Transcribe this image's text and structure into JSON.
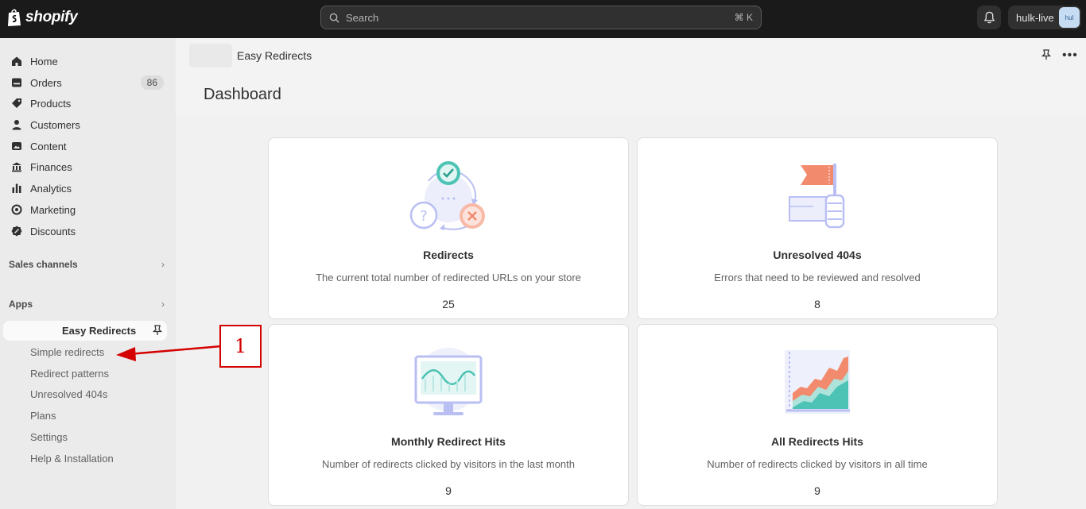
{
  "topbar": {
    "logo_text": "shopify",
    "search_placeholder": "Search",
    "search_shortcut": "⌘ K",
    "store_name": "hulk-live",
    "avatar_text": "hul"
  },
  "sidebar": {
    "items": [
      {
        "label": "Home",
        "icon": "home-icon"
      },
      {
        "label": "Orders",
        "icon": "orders-icon",
        "badge": "86"
      },
      {
        "label": "Products",
        "icon": "tag-icon"
      },
      {
        "label": "Customers",
        "icon": "person-icon"
      },
      {
        "label": "Content",
        "icon": "content-icon"
      },
      {
        "label": "Finances",
        "icon": "bank-icon"
      },
      {
        "label": "Analytics",
        "icon": "bar-chart-icon"
      },
      {
        "label": "Marketing",
        "icon": "target-icon"
      },
      {
        "label": "Discounts",
        "icon": "discount-icon"
      }
    ],
    "sales_channels_label": "Sales channels",
    "apps_label": "Apps",
    "active_app": "Easy Redirects",
    "app_subitems": [
      "Simple redirects",
      "Redirect patterns",
      "Unresolved 404s",
      "Plans",
      "Settings",
      "Help & Installation"
    ]
  },
  "main": {
    "app_title": "Easy Redirects",
    "page_title": "Dashboard",
    "cards": [
      {
        "title": "Redirects",
        "description": "The current total number of redirected URLs on your store",
        "value": "25"
      },
      {
        "title": "Unresolved 404s",
        "description": "Errors that need to be reviewed and resolved",
        "value": "8"
      },
      {
        "title": "Monthly Redirect Hits",
        "description": "Number of redirects clicked by visitors in the last month",
        "value": "9"
      },
      {
        "title": "All Redirects Hits",
        "description": "Number of redirects clicked by visitors in all time",
        "value": "9"
      }
    ]
  },
  "annotation": {
    "label": "1",
    "color": "#d40000"
  },
  "colors": {
    "topbar": "#1a1a1a",
    "accent_teal": "#4cc3b5",
    "accent_salmon": "#f28b6e",
    "illus_lavender": "#b9bff2"
  }
}
